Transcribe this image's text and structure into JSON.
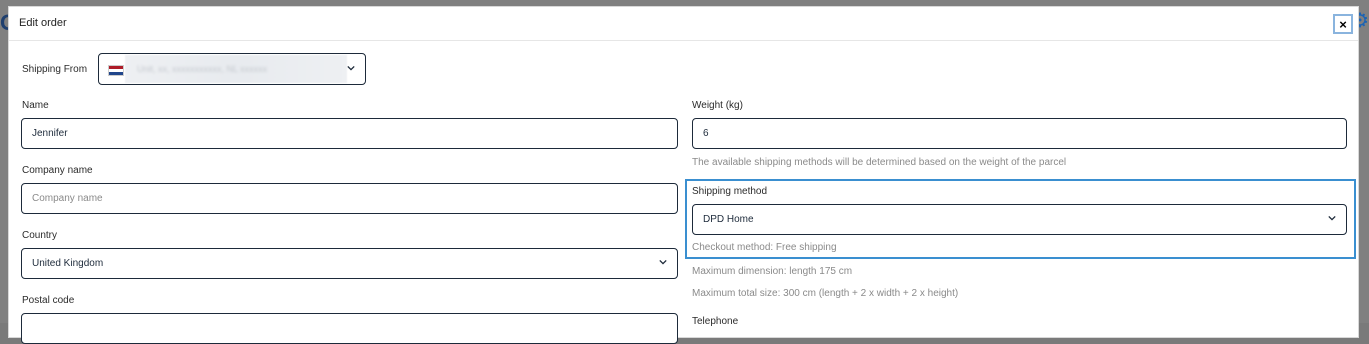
{
  "modal": {
    "title": "Edit order",
    "close_label": "×"
  },
  "shipping_from": {
    "label": "Shipping From",
    "address_redacted": "Unit, xx, xxxxxxxxxxx, NL xxxxxx"
  },
  "name": {
    "label": "Name",
    "value": "Jennifer"
  },
  "company": {
    "label": "Company name",
    "placeholder": "Company name"
  },
  "country": {
    "label": "Country",
    "value": "United Kingdom"
  },
  "postal": {
    "label": "Postal code"
  },
  "weight": {
    "label": "Weight (kg)",
    "value": "6",
    "hint": "The available shipping methods will be determined based on the weight of the parcel"
  },
  "shipping_method": {
    "label": "Shipping method",
    "value": "DPD Home",
    "checkout_note": "Checkout method: Free shipping"
  },
  "dimensions": {
    "max_dimension": "Maximum dimension: length 175 cm",
    "max_total": "Maximum total size: 300 cm (length + 2 x width + 2 x height)"
  },
  "telephone": {
    "label": "Telephone"
  },
  "colors": {
    "accent": "#3a8fd0",
    "border": "#1d2a3a",
    "hint": "#8a8a8a"
  }
}
